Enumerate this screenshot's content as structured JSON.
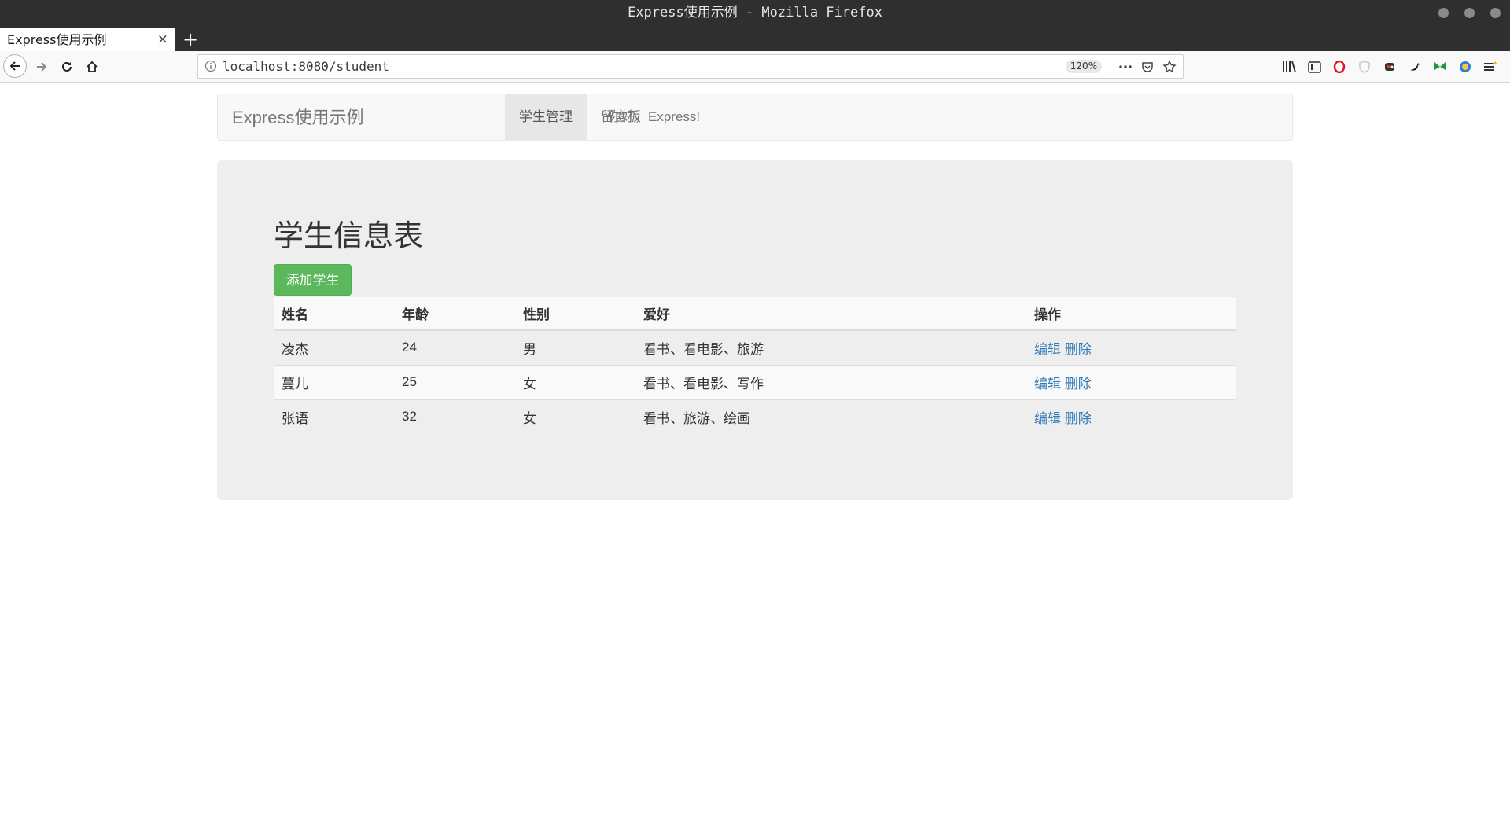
{
  "window": {
    "title": "Express使用示例 - Mozilla Firefox"
  },
  "tab": {
    "label": "Express使用示例",
    "close": "×",
    "new_tab": "+"
  },
  "address_bar": {
    "url": "localhost:8080/student",
    "zoom": "120%"
  },
  "icons": {
    "back": "back-arrow-icon",
    "forward": "forward-arrow-icon",
    "reload": "reload-icon",
    "home": "home-icon",
    "info": "info-icon",
    "more": "more-actions-icon",
    "pocket": "pocket-icon",
    "bookmark": "bookmark-star-icon",
    "library": "library-icon",
    "sidebar": "sidebar-icon",
    "menu": "hamburger-menu-icon"
  },
  "app": {
    "brand": "Express使用示例",
    "nav": [
      {
        "label": "你好，Express!",
        "active": false
      },
      {
        "label": "学生管理",
        "active": true
      },
      {
        "label": "留言板",
        "active": false
      }
    ]
  },
  "main": {
    "heading": "学生信息表",
    "add_button": "添加学生",
    "table": {
      "headers": [
        "姓名",
        "年龄",
        "性别",
        "爱好",
        "操作"
      ],
      "rows": [
        {
          "name": "凌杰",
          "age": "24",
          "gender": "男",
          "hobbies": "看书、看电影、旅游",
          "edit": "编辑",
          "delete": "删除"
        },
        {
          "name": "蔓儿",
          "age": "25",
          "gender": "女",
          "hobbies": "看书、看电影、写作",
          "edit": "编辑",
          "delete": "删除"
        },
        {
          "name": "张语",
          "age": "32",
          "gender": "女",
          "hobbies": "看书、旅游、绘画",
          "edit": "编辑",
          "delete": "删除"
        }
      ]
    }
  },
  "colors": {
    "link": "#337ab7",
    "success": "#5cb85c",
    "jumbotron": "#eeeeee",
    "titlebar": "#2f2f2f"
  }
}
